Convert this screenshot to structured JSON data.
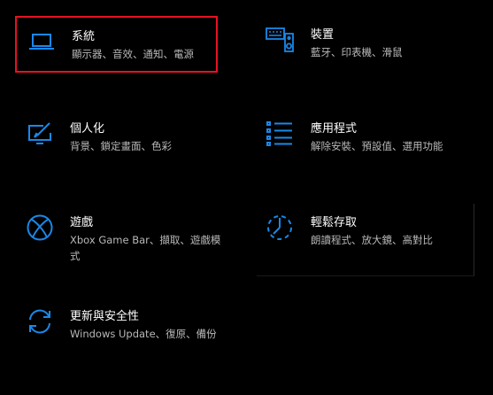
{
  "accent_color": "#1a88e8",
  "selection_color": "#e81123",
  "tiles": [
    {
      "title": "系統",
      "desc": "顯示器、音效、通知、電源",
      "icon": "laptop-icon"
    },
    {
      "title": "裝置",
      "desc": "藍牙、印表機、滑鼠",
      "icon": "keyboard-speaker-icon"
    },
    {
      "title": "個人化",
      "desc": "背景、鎖定畫面、色彩",
      "icon": "paint-monitor-icon"
    },
    {
      "title": "應用程式",
      "desc": "解除安裝、預設值、選用功能",
      "icon": "apps-list-icon"
    },
    {
      "title": "遊戲",
      "desc": "Xbox Game Bar、擷取、遊戲模式",
      "icon": "xbox-icon"
    },
    {
      "title": "輕鬆存取",
      "desc": "朗讀程式、放大鏡、高對比",
      "icon": "ease-of-access-icon"
    },
    {
      "title": "更新與安全性",
      "desc": "Windows Update、復原、備份",
      "icon": "sync-arrows-icon"
    }
  ]
}
